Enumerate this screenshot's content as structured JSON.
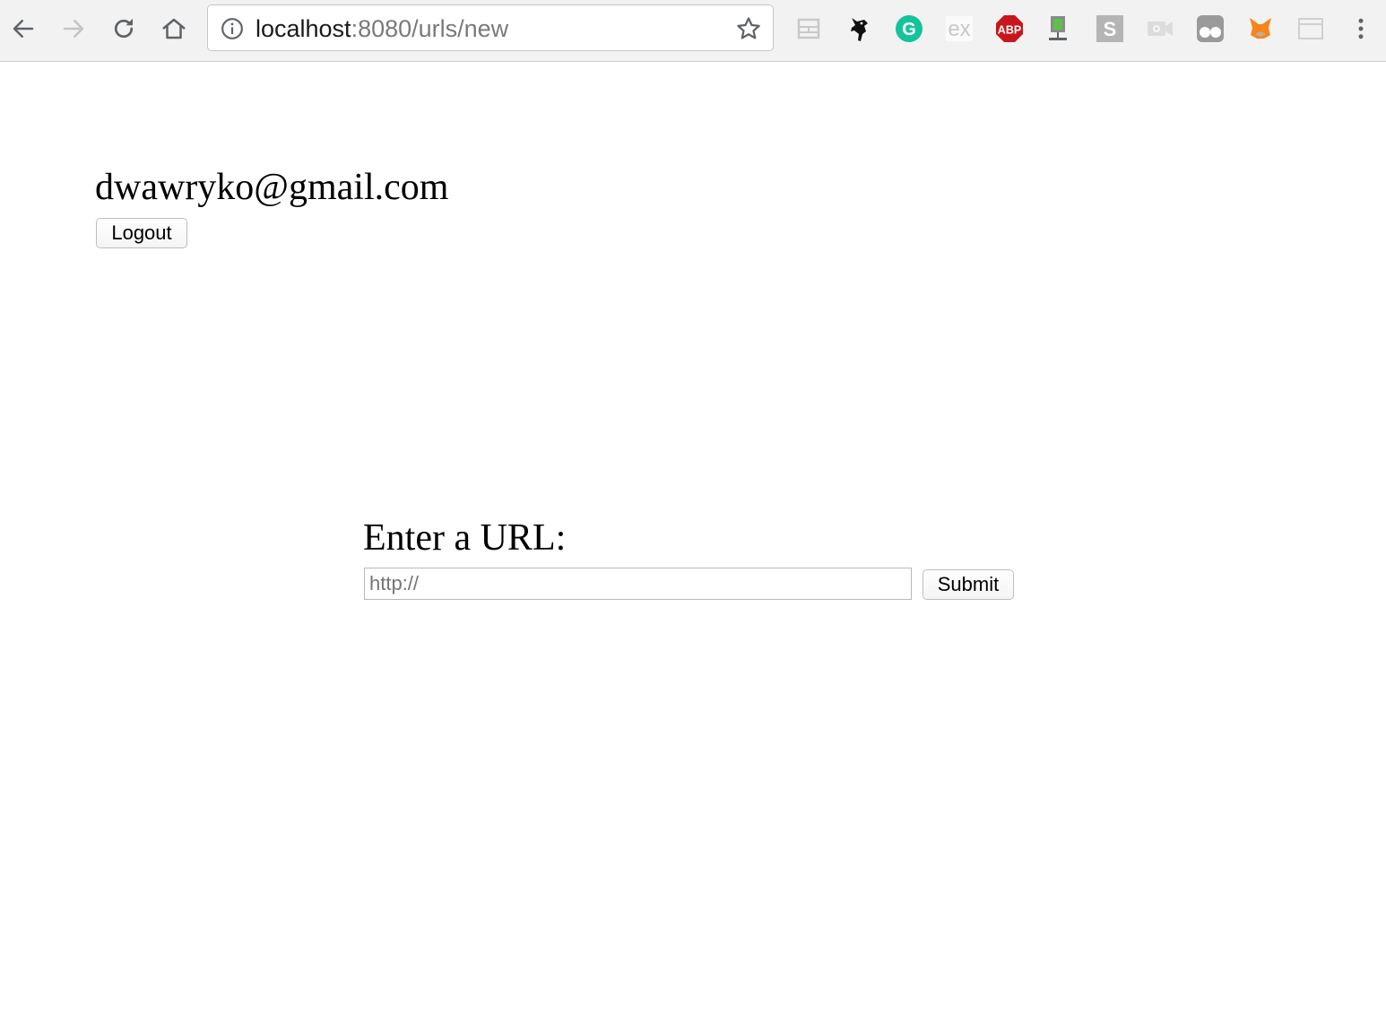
{
  "browser": {
    "url_host": "localhost",
    "url_rest": ":8080/urls/new",
    "nav_icons": [
      "back-icon",
      "forward-icon",
      "reload-icon",
      "home-icon"
    ],
    "extension_icons": [
      "reader-icon",
      "ninja-extension-icon",
      "grammarly-icon",
      "ex-extension-icon",
      "adblock-plus-icon",
      "network-extension-icon",
      "s-extension-icon",
      "video-extension-icon",
      "glasses-extension-icon",
      "metamask-icon",
      "window-extension-icon"
    ],
    "adblock_label": "ABP",
    "ex_label": "ex",
    "s_label": "S",
    "grammarly_label": "G",
    "colors": {
      "toolbar_bg": "#f2f2f2",
      "grammarly": "#15c39a",
      "adblock": "#c7161d",
      "metamask": "#f6851b"
    }
  },
  "page": {
    "user_email": "dwawryko@gmail.com",
    "logout_label": "Logout",
    "form": {
      "label": "Enter a URL:",
      "input_placeholder": "http://",
      "input_value": "",
      "submit_label": "Submit"
    }
  }
}
